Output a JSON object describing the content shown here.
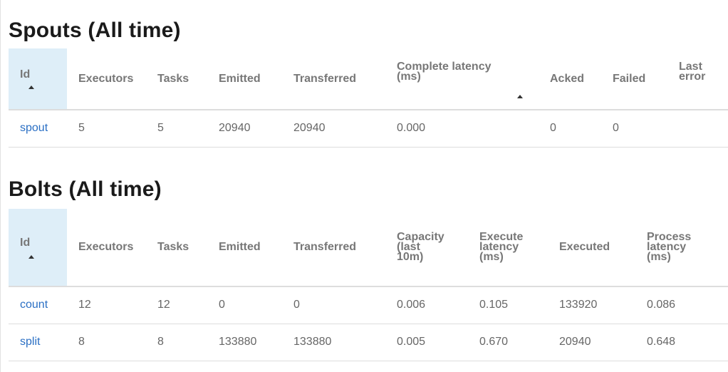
{
  "spouts": {
    "title": "Spouts (All time)",
    "columns": [
      "Id",
      "Executors",
      "Tasks",
      "Emitted",
      "Transferred",
      "Complete latency (ms)",
      "Acked",
      "Failed",
      "Last error"
    ],
    "headers": {
      "id": "Id",
      "executors": "Executors",
      "tasks": "Tasks",
      "emitted": "Emitted",
      "transferred": "Transferred",
      "complete_latency_1": "Complete latency",
      "complete_latency_2": "(ms)",
      "acked": "Acked",
      "failed": "Failed",
      "last_error_1": "Last",
      "last_error_2": "error"
    },
    "rows": [
      {
        "id": "spout",
        "executors": "5",
        "tasks": "5",
        "emitted": "20940",
        "transferred": "20940",
        "complete_latency": "0.000",
        "acked": "0",
        "failed": "0",
        "last_error": ""
      }
    ]
  },
  "bolts": {
    "title": "Bolts (All time)",
    "headers": {
      "id": "Id",
      "executors": "Executors",
      "tasks": "Tasks",
      "emitted": "Emitted",
      "transferred": "Transferred",
      "capacity_1": "Capacity",
      "capacity_2": "(last",
      "capacity_3": "10m)",
      "execute_latency_1": "Execute",
      "execute_latency_2": "latency",
      "execute_latency_3": "(ms)",
      "executed": "Executed",
      "process_latency_1": "Process",
      "process_latency_2": "latency",
      "process_latency_3": "(ms)"
    },
    "rows": [
      {
        "id": "count",
        "executors": "12",
        "tasks": "12",
        "emitted": "0",
        "transferred": "0",
        "capacity": "0.006",
        "execute_latency": "0.105",
        "executed": "133920",
        "process_latency": "0.086"
      },
      {
        "id": "split",
        "executors": "8",
        "tasks": "8",
        "emitted": "133880",
        "transferred": "133880",
        "capacity": "0.005",
        "execute_latency": "0.670",
        "executed": "20940",
        "process_latency": "0.648"
      }
    ]
  },
  "colors": {
    "link": "#2a6fc4",
    "sorted_header_bg": "#deeef8",
    "heading": "#1a1a1a",
    "header_text": "#777777",
    "border": "#dddddd"
  }
}
